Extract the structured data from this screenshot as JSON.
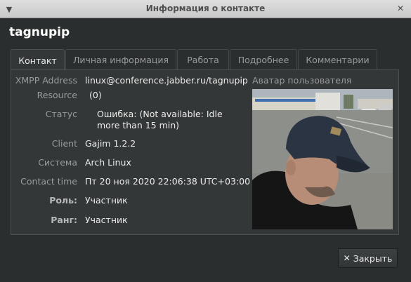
{
  "window": {
    "title": "Информация о контакте",
    "menu_icon": "chevron-down-icon",
    "close_icon": "close-icon"
  },
  "contact_name": "tagnupip",
  "tabs": [
    {
      "label": "Контакт",
      "active": true
    },
    {
      "label": "Личная информация",
      "active": false
    },
    {
      "label": "Работа",
      "active": false
    },
    {
      "label": "Подробнее",
      "active": false
    },
    {
      "label": "Комментарии",
      "active": false
    }
  ],
  "fields": {
    "xmpp_address": {
      "label": "XMPP Address",
      "value": "linux@conference.jabber.ru/tagnupip"
    },
    "resource": {
      "label": "Resource",
      "value": "(0)"
    },
    "status": {
      "label": "Статус",
      "value_line1": "Ошибка:  (Not available: Idle",
      "value_line2": "more than 15 min)"
    },
    "client": {
      "label": "Client",
      "value": "Gajim 1.2.2"
    },
    "system": {
      "label": "Система",
      "value": "Arch Linux"
    },
    "contact_time": {
      "label": "Contact time",
      "value": "Пт 20 ноя 2020 22:06:38 UTC+03:00"
    },
    "role": {
      "label": "Роль:",
      "value": "Участник"
    },
    "affiliation": {
      "label": "Ранг:",
      "value": "Участник"
    }
  },
  "avatar": {
    "label": "Аватар пользователя"
  },
  "buttons": {
    "close_label": "Закрыть",
    "close_icon": "close-icon"
  },
  "colors": {
    "background": "#2b2e2e",
    "panel": "#333737",
    "titlebar": "#d4d4d4"
  }
}
